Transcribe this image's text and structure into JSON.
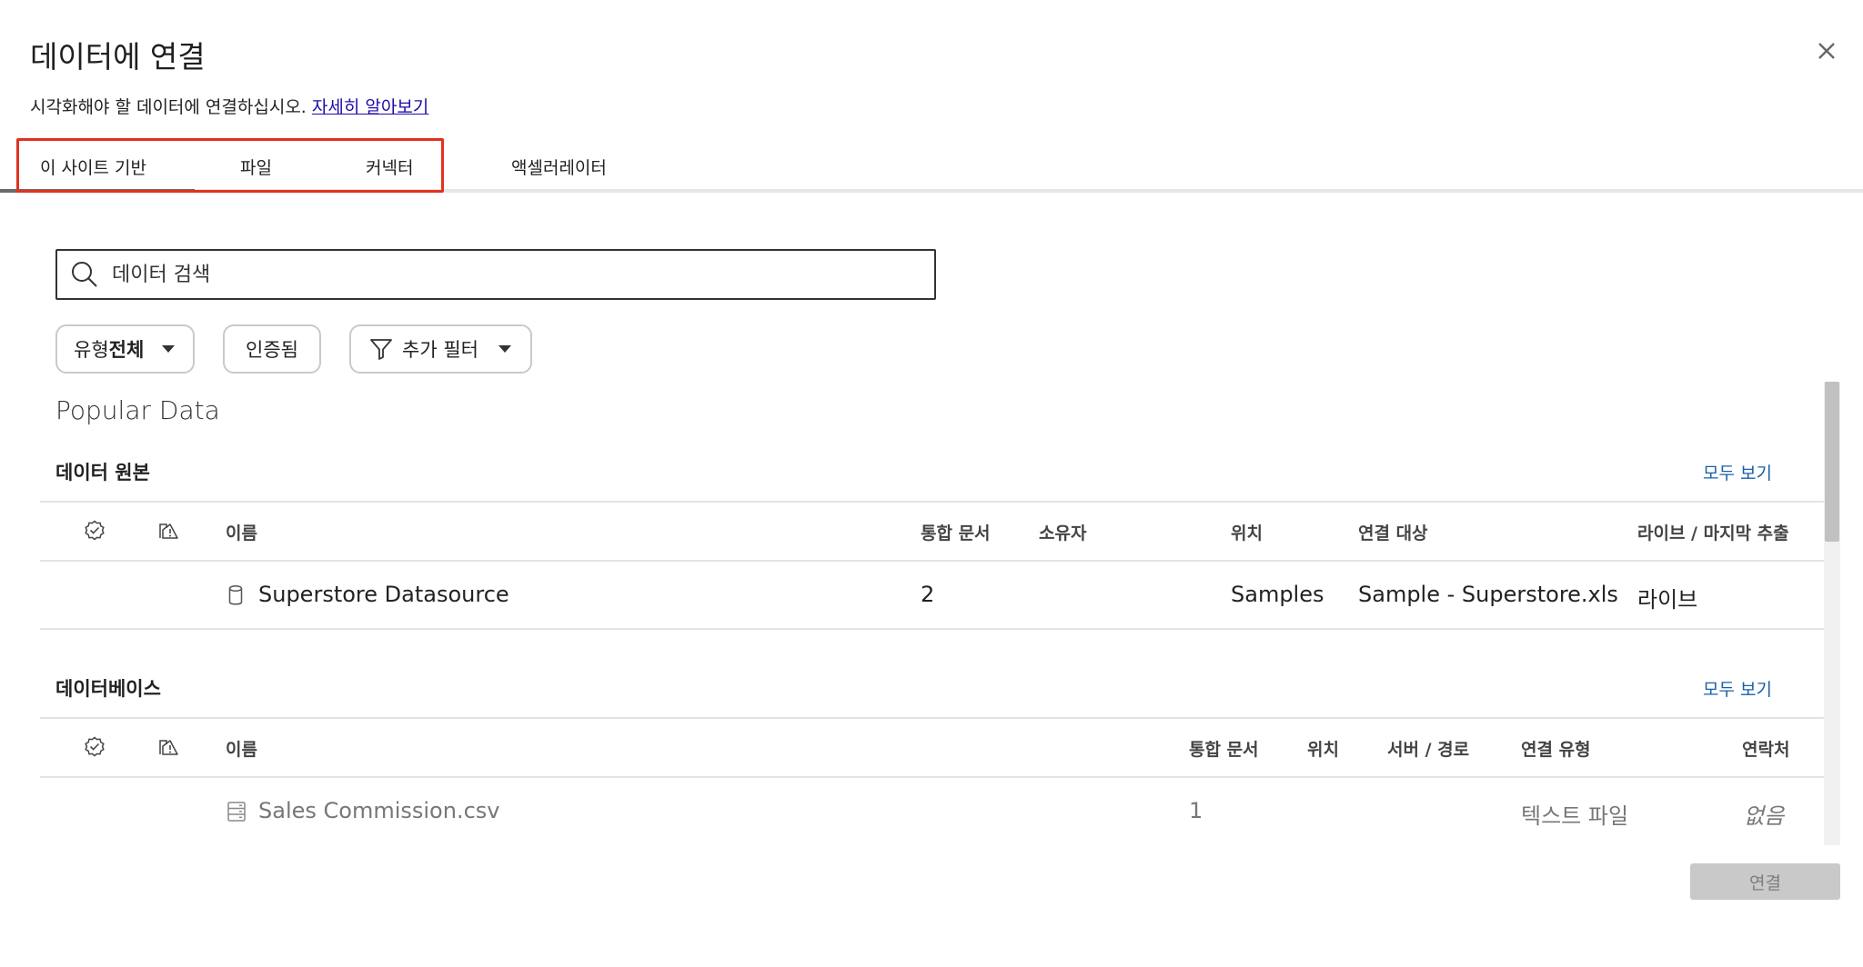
{
  "dialog": {
    "title": "데이터에 연결",
    "subtitle": "시각화해야 할 데이터에 연결하십시오.",
    "learn_more": "자세히 알아보기"
  },
  "tabs": [
    {
      "label": "이 사이트 기반",
      "active": true
    },
    {
      "label": "파일",
      "active": false
    },
    {
      "label": "커넥터",
      "active": false
    },
    {
      "label": "액셀러레이터",
      "active": false
    }
  ],
  "search": {
    "placeholder": "데이터 검색"
  },
  "filters": {
    "type_prefix": "유형",
    "type_value": "전체",
    "certified": "인증됨",
    "more_filters": "추가 필터"
  },
  "popular_heading": "Popular Data",
  "data_sources": {
    "title": "데이터 원본",
    "see_all": "모두 보기",
    "columns": {
      "name": "이름",
      "workbooks": "통합 문서",
      "owner": "소유자",
      "location": "위치",
      "connected_to": "연결 대상",
      "live_extract": "라이브 / 마지막 추출"
    },
    "rows": [
      {
        "name": "Superstore Datasource",
        "workbooks": "2",
        "owner": "",
        "location": "Samples",
        "connected_to": "Sample - Superstore.xls",
        "live_extract": "라이브"
      }
    ]
  },
  "databases": {
    "title": "데이터베이스",
    "see_all": "모두 보기",
    "columns": {
      "name": "이름",
      "workbooks": "통합 문서",
      "location": "위치",
      "server_path": "서버 / 경로",
      "connection_type": "연결 유형",
      "contact": "연락처"
    },
    "rows": [
      {
        "name": "Sales Commission.csv",
        "workbooks": "1",
        "location": "",
        "server_path": "",
        "connection_type": "텍스트 파일",
        "contact": "없음"
      }
    ]
  },
  "connect_button": "연결",
  "colors": {
    "link": "#1a0dab",
    "see_all": "#1a5fa8",
    "highlight": "#e0321f",
    "disabled_button": "#c9c9c9"
  }
}
